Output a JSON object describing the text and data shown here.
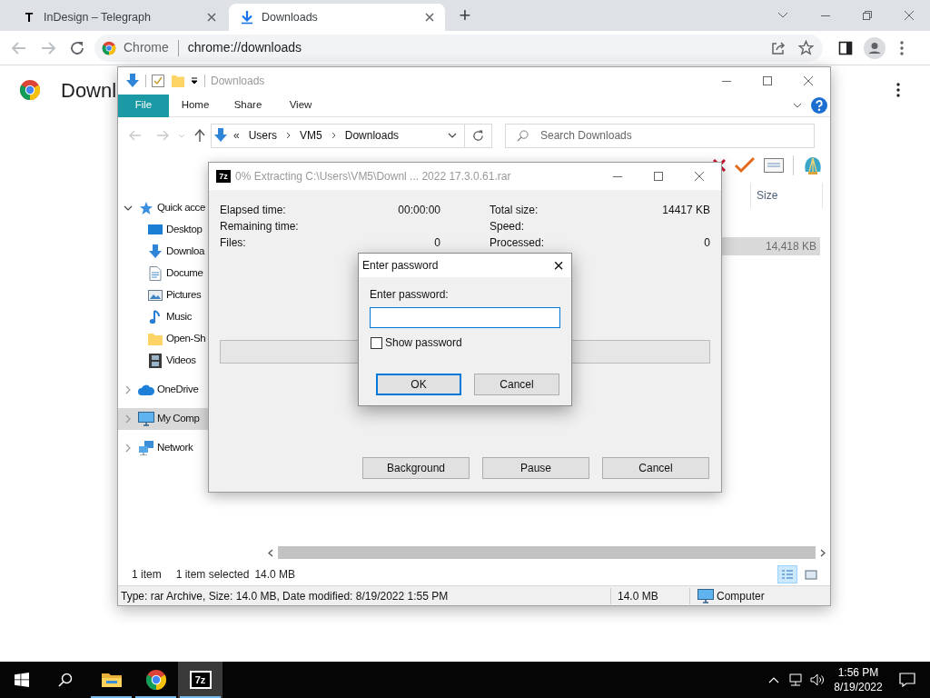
{
  "browser": {
    "tabs": [
      {
        "label": "InDesign – Telegraph",
        "favicon": "T",
        "selected": false
      },
      {
        "label": "Downloads",
        "selected": true
      }
    ],
    "new_tab": "+",
    "omnibox": {
      "site": "Chrome",
      "url": "chrome://downloads"
    }
  },
  "page": {
    "heading": "Downl"
  },
  "explorer": {
    "title": "Downloads",
    "ribbon_tabs": [
      {
        "label": "File",
        "selected": true
      },
      {
        "label": "Home",
        "selected": false
      },
      {
        "label": "Share",
        "selected": false
      },
      {
        "label": "View",
        "selected": false
      }
    ],
    "breadcrumb": {
      "overflow": "«",
      "parts": [
        "Users",
        "VM5",
        "Downloads"
      ]
    },
    "search": {
      "placeholder": "Search Downloads"
    },
    "nav": [
      {
        "label": "Quick acce",
        "kind": "star",
        "expanded": true,
        "selected": false,
        "children": [
          {
            "label": "Desktop",
            "kind": "desktop",
            "selected": false
          },
          {
            "label": "Downloa",
            "kind": "download",
            "selected": false
          },
          {
            "label": "Docume",
            "kind": "document",
            "selected": false
          },
          {
            "label": "Pictures",
            "kind": "pictures",
            "selected": false
          },
          {
            "label": "Music",
            "kind": "music",
            "selected": false
          },
          {
            "label": "Open-Sh",
            "kind": "folder",
            "selected": false
          },
          {
            "label": "Videos",
            "kind": "videos",
            "selected": false
          }
        ]
      },
      {
        "label": "OneDrive",
        "kind": "cloud",
        "expanded": false,
        "selected": false
      },
      {
        "label": "My Comp",
        "kind": "computer",
        "expanded": false,
        "selected": true
      },
      {
        "label": "Network",
        "kind": "network",
        "expanded": false,
        "selected": false
      }
    ],
    "columns": [
      "Size"
    ],
    "rows": [
      {
        "size": "14,418 KB",
        "selected": true
      }
    ],
    "status": {
      "count": "1 item",
      "selection": "1 item selected",
      "size": "14.0 MB"
    },
    "views": [
      {
        "kind": "details",
        "selected": true
      },
      {
        "kind": "tiles",
        "selected": false
      }
    ],
    "details_bar": {
      "info": "Type: rar Archive, Size: 14.0 MB, Date modified: 8/19/2022 1:55 PM",
      "size": "14.0 MB",
      "location": "Computer"
    }
  },
  "extract_dialog": {
    "icon_text": "7z",
    "title": "0% Extracting C:\\Users\\VM5\\Downl ... 2022 17.3.0.61.rar",
    "stats": [
      {
        "label": "Elapsed time:",
        "value": "00:00:00"
      },
      {
        "label": "Total size:",
        "value": "14417 KB"
      },
      {
        "label": "Remaining time:"
      },
      {
        "label": "Speed:"
      },
      {
        "label": "Files:",
        "value": "0"
      },
      {
        "label": "Processed:",
        "value": "0"
      }
    ],
    "progress": {
      "level": 0
    },
    "buttons": [
      "Background",
      "Pause",
      "Cancel"
    ]
  },
  "password_dialog": {
    "title": "Enter password",
    "close": "×",
    "label": "Enter password:",
    "show_password": {
      "label": "Show password",
      "checked": false
    },
    "buttons": [
      {
        "label": "OK",
        "default": true
      },
      {
        "label": "Cancel",
        "default": false
      }
    ]
  },
  "taskbar": {
    "apps": [
      {
        "kind": "explorer",
        "running": true,
        "active": false
      },
      {
        "kind": "chrome",
        "running": true,
        "active": false
      },
      {
        "kind": "sevenzip",
        "label": "7z",
        "running": true,
        "active": true
      }
    ],
    "time": "1:56 PM",
    "date": "8/19/2022"
  }
}
